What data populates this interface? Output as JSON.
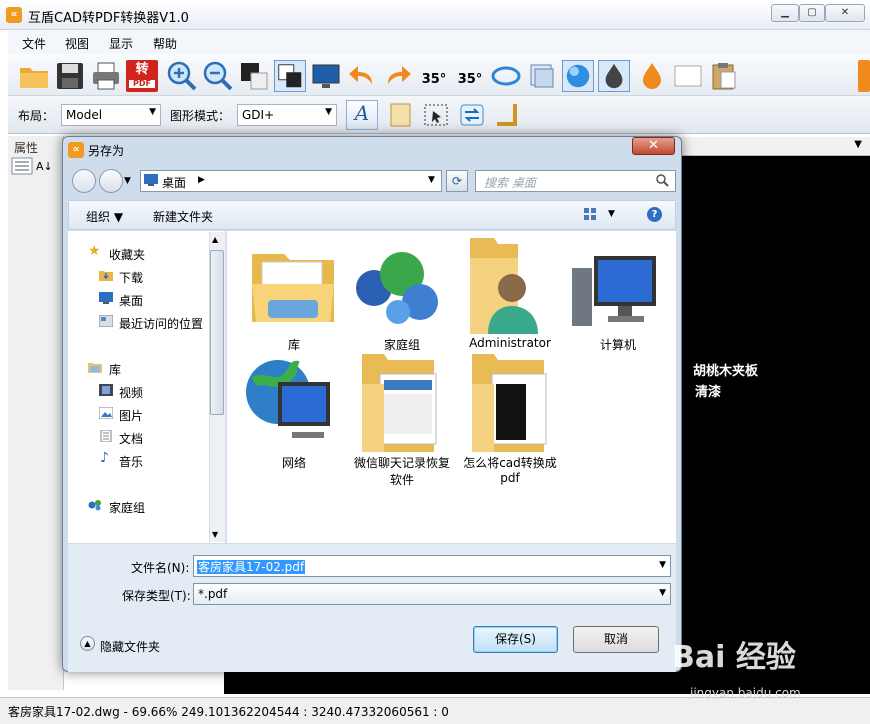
{
  "app": {
    "title": "互盾CAD转PDF转换器V1.0",
    "icon": "∝"
  },
  "window_controls": {
    "min": "▁",
    "max": "▢",
    "close": "✕"
  },
  "menu": [
    "文件",
    "视图",
    "显示",
    "帮助"
  ],
  "toolbar": {
    "angle_left": "35°",
    "angle_right": "35°",
    "convert_label": "转"
  },
  "options": {
    "layout_label": "布局：",
    "layout_value": "Model",
    "mode_label": "图形模式：",
    "mode_value": "GDI+"
  },
  "left_panel": {
    "title": "属性"
  },
  "canvas": {
    "text_line1": "胡桃木夹板",
    "text_line2": "清漆"
  },
  "status": {
    "text": "客房家具17-02.dwg - 69.66%  249.101362204544 : 3240.47332060561 : 0"
  },
  "dialog": {
    "title": "另存为",
    "close": "✕",
    "address": "桌面",
    "search_placeholder": "搜索 桌面",
    "organize": "组织 ▼",
    "new_folder": "新建文件夹",
    "help": "?",
    "nav": {
      "favorites": "收藏夹",
      "downloads": "下载",
      "desktop": "桌面",
      "recent": "最近访问的位置",
      "libraries": "库",
      "videos": "视频",
      "pictures": "图片",
      "documents": "文档",
      "music": "音乐",
      "homegroup": "家庭组"
    },
    "items": [
      {
        "label": "库"
      },
      {
        "label": "家庭组"
      },
      {
        "label": "Administrator"
      },
      {
        "label": "计算机"
      },
      {
        "label": "网络"
      },
      {
        "label": "微信聊天记录恢复软件"
      },
      {
        "label": "怎么将cad转换成pdf"
      }
    ],
    "filename_label": "文件名(N):",
    "filename_value": "客房家具17-02.pdf",
    "filetype_label": "保存类型(T):",
    "filetype_value": "*.pdf",
    "hide_folders": "隐藏文件夹",
    "save": "保存(S)",
    "cancel": "取消"
  },
  "watermark": {
    "brand": "Bai 经验",
    "url": "jingyan.baidu.com"
  }
}
